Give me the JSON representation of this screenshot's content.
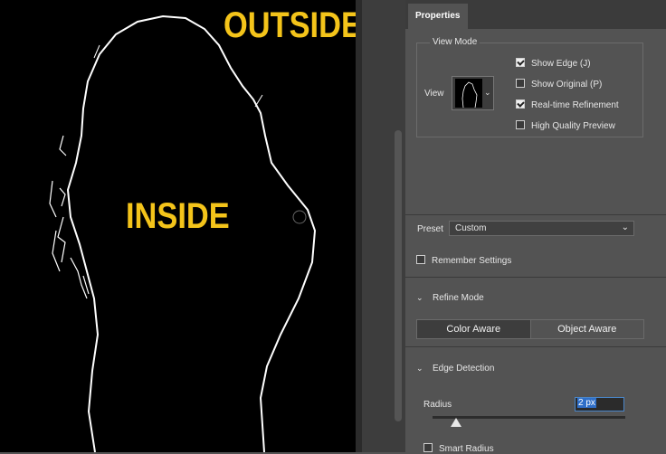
{
  "canvas": {
    "outside_label": "OUTSIDE",
    "inside_label": "INSIDE"
  },
  "panel": {
    "tab_title": "Properties",
    "view_mode": {
      "group_title": "View Mode",
      "view_label": "View",
      "options": [
        {
          "label": "Show Edge (J)",
          "checked": true
        },
        {
          "label": "Show Original (P)",
          "checked": false
        },
        {
          "label": "Real-time Refinement",
          "checked": true
        },
        {
          "label": "High Quality Preview",
          "checked": false
        }
      ]
    },
    "preset": {
      "label": "Preset",
      "value": "Custom"
    },
    "remember_settings": {
      "label": "Remember Settings",
      "checked": false
    },
    "refine_mode": {
      "title": "Refine Mode",
      "options": [
        "Color Aware",
        "Object Aware"
      ],
      "selected": "Color Aware"
    },
    "edge_detection": {
      "title": "Edge Detection",
      "radius_label": "Radius",
      "radius_value": "2 px",
      "smart_radius_label": "Smart Radius"
    }
  },
  "colors": {
    "label_yellow": "#f4c41a",
    "panel_bg": "#535353",
    "canvas_bg": "#000000",
    "selection_blue": "#2f6fc8"
  }
}
